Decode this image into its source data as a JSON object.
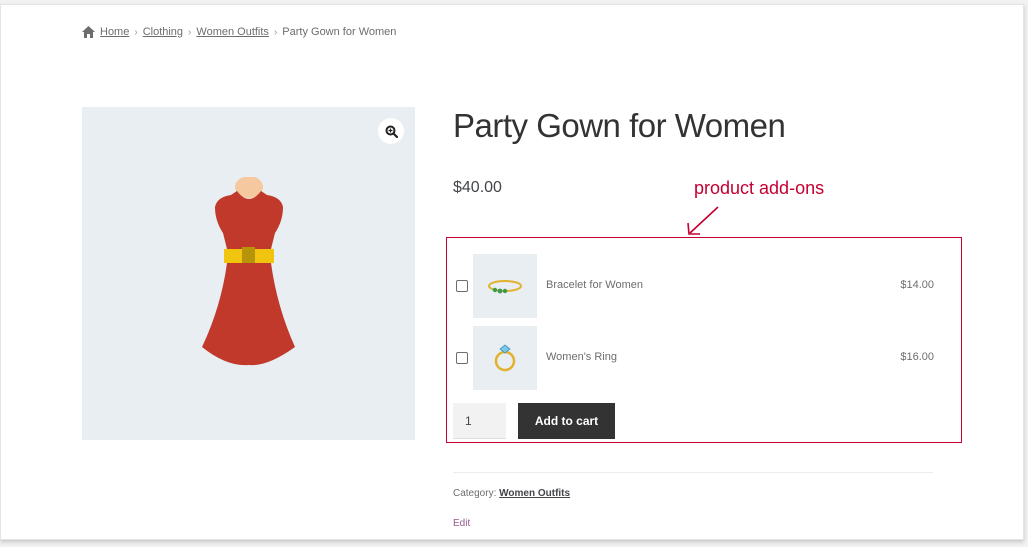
{
  "breadcrumb": {
    "home": "Home",
    "clothing": "Clothing",
    "women_outfits": "Women Outfits",
    "current": "Party Gown for Women",
    "separator": "›"
  },
  "product": {
    "title": "Party Gown for Women",
    "price": "$40.00",
    "dress_color": "#c0392b",
    "belt_color": "#f1c40f"
  },
  "annotation": {
    "text": "product add-ons",
    "color": "#c40031"
  },
  "addons": [
    {
      "name": "Bracelet for Women",
      "price": "$14.00",
      "checked": false,
      "icon": "bracelet-icon"
    },
    {
      "name": "Women's Ring",
      "price": "$16.00",
      "checked": false,
      "icon": "ring-icon"
    }
  ],
  "cart": {
    "quantity": "1",
    "button_label": "Add to cart"
  },
  "meta": {
    "category_label": "Category:",
    "category_value": "Women Outfits",
    "edit_label": "Edit"
  }
}
